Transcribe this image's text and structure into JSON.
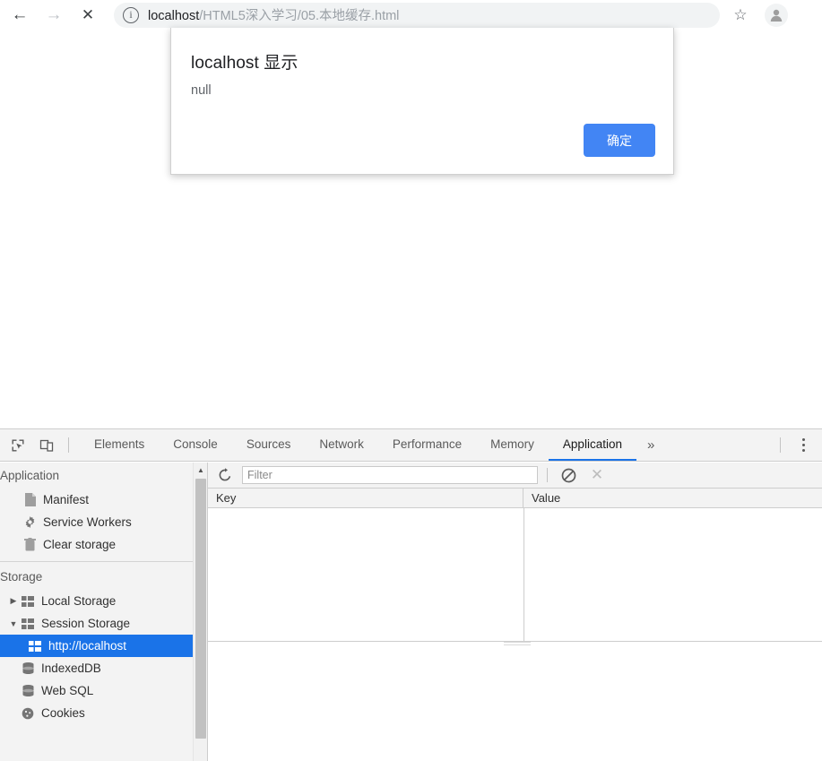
{
  "browser": {
    "nav": {
      "back_icon": "arrow-left-icon",
      "back_glyph": "←",
      "forward_icon": "arrow-right-icon",
      "forward_glyph": "→",
      "stop_icon": "close-icon",
      "stop_glyph": "✕"
    },
    "omnibox": {
      "site_info_glyph": "ⓘ",
      "url_host": "localhost",
      "url_path": "/HTML5深入学习/05.本地缓存.html",
      "full_url": "localhost/HTML5深入学习/05.本地缓存.html"
    },
    "bookmark_glyph": "☆",
    "avatar_name": "profile-avatar"
  },
  "dialog": {
    "title": "localhost 显示",
    "message": "null",
    "ok_label": "确定",
    "accent_color": "#4285f4"
  },
  "devtools": {
    "toolbar": {
      "inspect_icon": "inspect-element-icon",
      "device_icon": "device-toolbar-icon",
      "overflow_glyph": "»",
      "kebab_icon": "more-options-icon"
    },
    "tabs": [
      {
        "label": "Elements",
        "active": false
      },
      {
        "label": "Console",
        "active": false
      },
      {
        "label": "Sources",
        "active": false
      },
      {
        "label": "Network",
        "active": false
      },
      {
        "label": "Performance",
        "active": false
      },
      {
        "label": "Memory",
        "active": false
      },
      {
        "label": "Application",
        "active": true
      }
    ],
    "active_tab": "Application",
    "accent_color": "#1a73e8",
    "sidebar": {
      "sections": [
        {
          "title": "Application",
          "items": [
            {
              "label": "Manifest",
              "icon": "document-icon",
              "indent": "child"
            },
            {
              "label": "Service Workers",
              "icon": "gear-icon",
              "indent": "child"
            },
            {
              "label": "Clear storage",
              "icon": "trash-icon",
              "indent": "child"
            }
          ]
        },
        {
          "title": "Storage",
          "items": [
            {
              "label": "Local Storage",
              "icon": "table-icon",
              "indent": "child",
              "twisty": "▶",
              "expanded": false
            },
            {
              "label": "Session Storage",
              "icon": "table-icon",
              "indent": "child",
              "twisty": "▼",
              "expanded": true
            },
            {
              "label": "http://localhost",
              "icon": "table-icon",
              "indent": "grandchild",
              "selected": true
            },
            {
              "label": "IndexedDB",
              "icon": "database-icon",
              "indent": "child"
            },
            {
              "label": "Web SQL",
              "icon": "database-icon",
              "indent": "child"
            },
            {
              "label": "Cookies",
              "icon": "cookie-icon",
              "indent": "child",
              "clipped": true
            }
          ]
        }
      ]
    },
    "panel": {
      "refresh_icon": "refresh-icon",
      "filter_placeholder": "Filter",
      "filter_value": "",
      "clear_all_icon": "clear-all-icon",
      "delete_selected_icon": "delete-icon",
      "table": {
        "columns": [
          "Key",
          "Value"
        ],
        "rows": []
      }
    }
  }
}
